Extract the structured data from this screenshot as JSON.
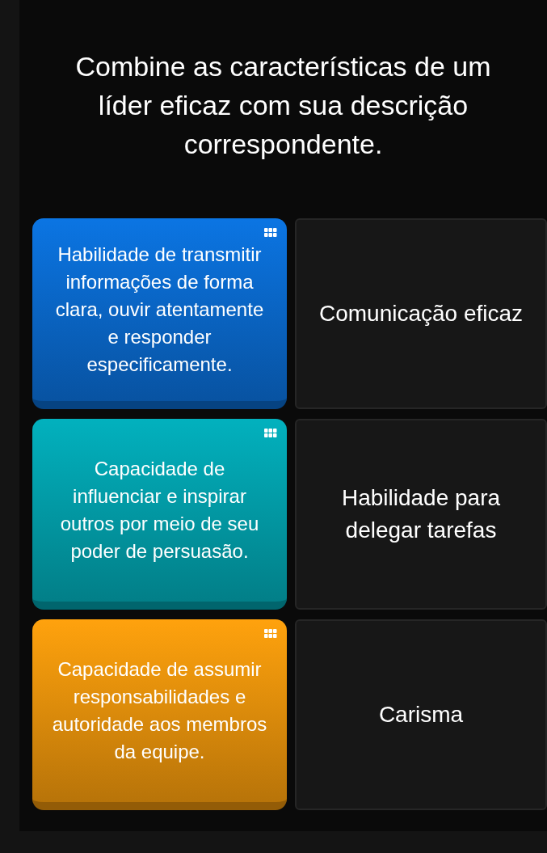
{
  "question": "Combine as características de um líder eficaz com sua descrição correspondente.",
  "pairs": [
    {
      "card": {
        "text": "Habilidade de transmitir informações de forma clara, ouvir atentamente e responder especificamente.",
        "color": "#0a6fd8"
      },
      "target": "Comunicação eficaz"
    },
    {
      "card": {
        "text": "Capacidade de influenciar e inspirar outros por meio de seu poder de persuasão.",
        "color": "#02a9b5"
      },
      "target": "Habilidade para delegar tarefas"
    },
    {
      "card": {
        "text": "Capacidade de assumir responsabilidades e autoridade aos membros da equipe.",
        "color": "#f59a0c"
      },
      "target": "Carisma"
    }
  ]
}
